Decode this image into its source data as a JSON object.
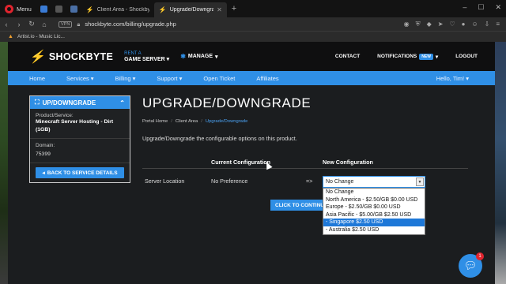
{
  "browser": {
    "menu_label": "Menu",
    "tabs": [
      {
        "title": "Client Area - Shockbyte",
        "active": false
      },
      {
        "title": "Upgrade/Downgrade - Sh",
        "active": true
      }
    ],
    "new_tab": "+",
    "url": "shockbyte.com/billing/upgrade.php",
    "vpn_label": "VPN",
    "bookmark": "Artist.io - Music Lic..."
  },
  "site": {
    "logo": "SHOCKBYTE",
    "rent_top": "RENT A",
    "rent_bottom": "GAME SERVER",
    "manage": "MANAGE",
    "header_links": {
      "contact": "CONTACT",
      "notifications": "NOTIFICATIONS",
      "new_badge": "NEW",
      "logout": "LOGOUT"
    },
    "nav": [
      "Home",
      "Services",
      "Billing",
      "Support",
      "Open Ticket",
      "Affiliates"
    ],
    "nav_user": "Hello, Tim!"
  },
  "sidebar": {
    "title": "UP/DOWNGRADE",
    "product_label": "Product/Service:",
    "product_value": "Minecraft Server Hosting - Dirt (1GB)",
    "domain_label": "Domain:",
    "domain_value": "75399",
    "back_button": "BACK TO SERVICE DETAILS"
  },
  "main": {
    "title": "UPGRADE/DOWNGRADE",
    "breadcrumb": [
      "Portal Home",
      "Client Area",
      "Upgrade/Downgrade"
    ],
    "intro": "Upgrade/Downgrade the configurable options on this product.",
    "col_current": "Current Configuration",
    "col_new": "New Configuration",
    "row_label": "Server Location",
    "row_current": "No Preference",
    "row_arrow": "=>",
    "select_value": "No Change",
    "continue_button": "CLICK TO CONTINUE",
    "options": [
      "No Change",
      "North America - $2.50/GB $0.00 USD",
      "Europe - $2.50/GB $0.00 USD",
      "Asia Pacific - $5.00/GB $2.50 USD",
      "- Singapore $2.50 USD",
      "- Australia $2.50 USD"
    ],
    "selected_option_index": 4
  },
  "chat": {
    "badge": "1"
  },
  "colors": {
    "accent": "#2f8fe6",
    "header": "#0f0f10",
    "page_bg": "#1b1d1f"
  }
}
